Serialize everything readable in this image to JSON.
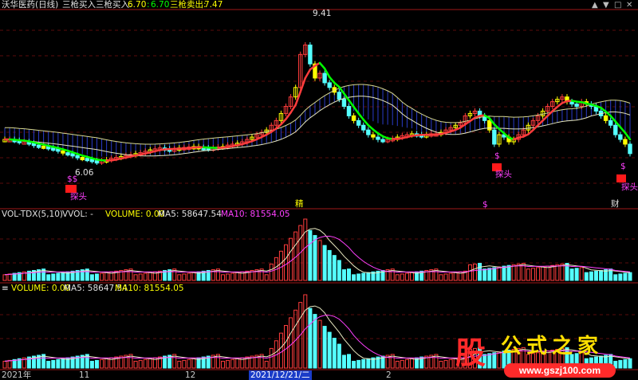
{
  "header": {
    "title": "沃华医药(日线)",
    "ind_name": "三枪买入",
    "buy_label": "三枪买入:",
    "buy_val": "6.70",
    "val2_prefix": ":",
    "val2": "6.70",
    "sell_label": "三枪卖出:",
    "sell_val": "7.47"
  },
  "win_controls": [
    "▲",
    "▼",
    "□",
    "✕"
  ],
  "price_labels": {
    "high": "9.41",
    "low": "6.06"
  },
  "markers": {
    "dollar": "$",
    "dollar2": "$$",
    "tantou": "探头",
    "jing": "精",
    "cai": "财"
  },
  "vol_tdx": {
    "name": "VOL-TDX(5,10)",
    "vvol": "VVOL: -",
    "volume": "VOLUME: 0.00",
    "ma5": "MA5: 58647.54",
    "ma10": "MA10: 81554.05"
  },
  "volume_panel": {
    "volume": "VOLUME: 0.00",
    "ma5": "MA5: 58647.54",
    "ma10": "MA10: 81554.05"
  },
  "dates": {
    "d1": "2021年",
    "d2": "11",
    "d3": "12",
    "d4": "2021/12/21/二",
    "d5": "2"
  },
  "watermark": {
    "logo": "股",
    "name": "公式之家",
    "url": "www.gszj100.com"
  },
  "colors": {
    "up": "#ff3c3c",
    "down": "#54ffff",
    "yellow": "#ffff00",
    "green": "#00ff00",
    "magenta": "#ff40ff",
    "grid": "#8a1010"
  },
  "chart_data": {
    "type": "candlestick",
    "n": 130,
    "closes": [
      7.0,
      7.0,
      6.98,
      6.95,
      6.95,
      6.92,
      6.88,
      6.86,
      6.85,
      6.82,
      6.8,
      6.76,
      6.72,
      6.7,
      6.66,
      6.62,
      6.6,
      6.58,
      6.55,
      6.52,
      6.55,
      6.57,
      6.6,
      6.62,
      6.64,
      6.66,
      6.68,
      6.7,
      6.72,
      6.75,
      6.78,
      6.8,
      6.82,
      6.8,
      6.78,
      6.8,
      6.82,
      6.83,
      6.84,
      6.85,
      6.83,
      6.82,
      6.8,
      6.82,
      6.84,
      6.85,
      6.88,
      6.9,
      6.92,
      6.95,
      7.0,
      7.05,
      7.1,
      7.15,
      7.2,
      7.3,
      7.4,
      7.55,
      7.7,
      7.9,
      8.1,
      8.8,
      9.0,
      8.6,
      8.3,
      8.4,
      8.2,
      8.1,
      8.0,
      7.85,
      7.7,
      7.5,
      7.4,
      7.3,
      7.2,
      7.1,
      7.05,
      7.0,
      6.98,
      7.0,
      7.02,
      7.05,
      7.08,
      7.1,
      7.12,
      7.1,
      7.08,
      7.1,
      7.12,
      7.12,
      7.15,
      7.2,
      7.25,
      7.3,
      7.35,
      7.5,
      7.55,
      7.6,
      7.5,
      7.4,
      7.2,
      6.9,
      7.1,
      7.05,
      6.95,
      7.0,
      7.1,
      7.2,
      7.3,
      7.4,
      7.5,
      7.6,
      7.7,
      7.8,
      7.85,
      7.9,
      7.8,
      7.75,
      7.7,
      7.8,
      7.75,
      7.7,
      7.6,
      7.5,
      7.4,
      7.3,
      7.1,
      7.0,
      6.9,
      6.7
    ],
    "ylim": [
      5.6,
      9.7
    ],
    "volume_peak_index": 62,
    "low_label": "6.06",
    "high_label": "9.41"
  }
}
